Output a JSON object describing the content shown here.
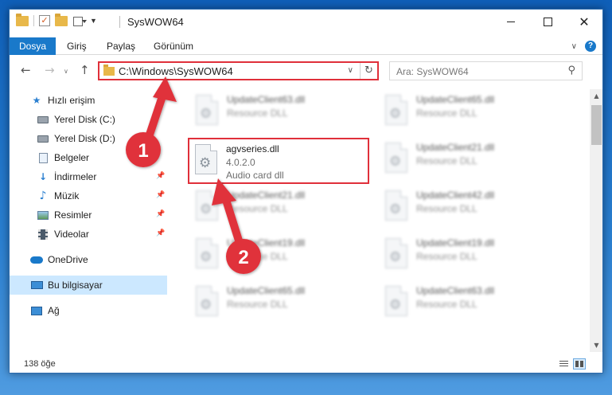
{
  "window": {
    "title": "SysWOW64"
  },
  "ribbon": {
    "tabs": [
      "Dosya",
      "Giriş",
      "Paylaş",
      "Görünüm"
    ]
  },
  "address": {
    "path": "C:\\Windows\\SysWOW64"
  },
  "search": {
    "placeholder": "Ara: SysWOW64"
  },
  "sidebar": {
    "items": [
      {
        "label": "Hızlı erişim",
        "icon": "star-icon"
      },
      {
        "label": "Yerel Disk (C:)",
        "icon": "drive-icon"
      },
      {
        "label": "Yerel Disk (D:)",
        "icon": "drive-icon"
      },
      {
        "label": "Belgeler",
        "icon": "documents-icon"
      },
      {
        "label": "İndirmeler",
        "icon": "downloads-icon"
      },
      {
        "label": "Müzik",
        "icon": "music-icon"
      },
      {
        "label": "Resimler",
        "icon": "pictures-icon"
      },
      {
        "label": "Videolar",
        "icon": "videos-icon"
      },
      {
        "label": "OneDrive",
        "icon": "cloud-icon"
      },
      {
        "label": "Bu bilgisayar",
        "icon": "computer-icon"
      },
      {
        "label": "Ağ",
        "icon": "network-icon"
      }
    ]
  },
  "files": [
    {
      "name": "UpdateClient63.dll",
      "sub1": "Resource DLL",
      "sub2": ""
    },
    {
      "name": "UpdateClient65.dll",
      "sub1": "Resource DLL",
      "sub2": ""
    },
    {
      "name": "agvseries.dll",
      "sub1": "4.0.2.0",
      "sub2": "Audio card dll"
    },
    {
      "name": "UpdateClient21.dll",
      "sub1": "Resource DLL",
      "sub2": ""
    },
    {
      "name": "UpdateClient21.dll",
      "sub1": "Resource DLL",
      "sub2": ""
    },
    {
      "name": "UpdateClient42.dll",
      "sub1": "Resource DLL",
      "sub2": ""
    },
    {
      "name": "UpdateClient19.dll",
      "sub1": "Resource DLL",
      "sub2": ""
    },
    {
      "name": "UpdateClient19.dll",
      "sub1": "Resource DLL",
      "sub2": ""
    },
    {
      "name": "UpdateClient65.dll",
      "sub1": "Resource DLL",
      "sub2": ""
    },
    {
      "name": "UpdateClient63.dll",
      "sub1": "Resource DLL",
      "sub2": ""
    }
  ],
  "status": {
    "count": "138 öğe"
  },
  "annotations": {
    "step1": "1",
    "step2": "2",
    "color": "#e0303a"
  }
}
